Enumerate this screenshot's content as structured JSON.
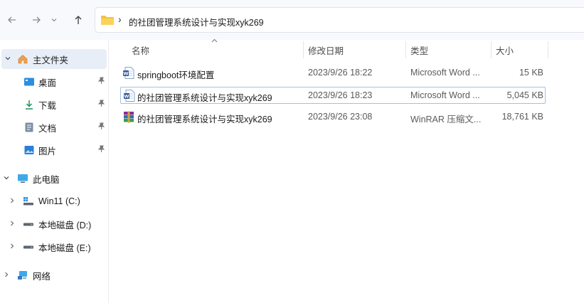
{
  "address_bar": {
    "crumb": "的社团管理系统设计与实现xyk269"
  },
  "sidebar": {
    "home": "主文件夹",
    "quick_access": [
      {
        "label": "桌面",
        "icon": "desktop-icon"
      },
      {
        "label": "下载",
        "icon": "download-icon"
      },
      {
        "label": "文档",
        "icon": "document-icon"
      },
      {
        "label": "图片",
        "icon": "picture-icon"
      }
    ],
    "this_pc": "此电脑",
    "drives": [
      {
        "label": "Win11 (C:)"
      },
      {
        "label": "本地磁盘 (D:)"
      },
      {
        "label": "本地磁盘 (E:)"
      }
    ],
    "network": "网络"
  },
  "columns": {
    "name": "名称",
    "modified": "修改日期",
    "type": "类型",
    "size": "大小"
  },
  "files": [
    {
      "name": "springboot环境配置",
      "modified": "2023/9/26 18:22",
      "type": "Microsoft Word ...",
      "size": "15 KB",
      "icon": "word-doc-icon"
    },
    {
      "name": "的社团管理系统设计与实现xyk269",
      "modified": "2023/9/26 18:23",
      "type": "Microsoft Word ...",
      "size": "5,045 KB",
      "icon": "word-doc-icon"
    },
    {
      "name": "的社团管理系统设计与实现xyk269",
      "modified": "2023/9/26 23:08",
      "type": "WinRAR 压缩文...",
      "size": "18,761 KB",
      "icon": "winrar-archive-icon"
    }
  ],
  "colors": {
    "accent": "#0067c0",
    "selection": "#e8eef7",
    "focus_border": "#9fc1e8",
    "folder": "#f5c242"
  }
}
